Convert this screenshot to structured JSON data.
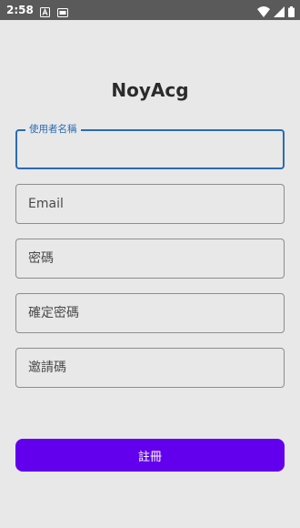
{
  "status_bar": {
    "time": "2:58",
    "icons": [
      "notification-a-icon",
      "sim-card-icon",
      "wifi-icon",
      "cell-signal-icon",
      "battery-icon"
    ]
  },
  "app": {
    "title": "NoyAcg"
  },
  "form": {
    "username": {
      "label": "使用者名稱",
      "value": ""
    },
    "email": {
      "placeholder": "Email",
      "value": ""
    },
    "password": {
      "placeholder": "密碼",
      "value": ""
    },
    "confirm_password": {
      "placeholder": "確定密碼",
      "value": ""
    },
    "invite_code": {
      "placeholder": "邀請碼",
      "value": ""
    }
  },
  "register_button": {
    "label": "註冊"
  },
  "colors": {
    "background": "#e8e8e8",
    "status_bar": "#5a5a5a",
    "focus_accent": "#2a6bb3",
    "button": "#6200ee",
    "field_border": "#8d8d8d"
  }
}
